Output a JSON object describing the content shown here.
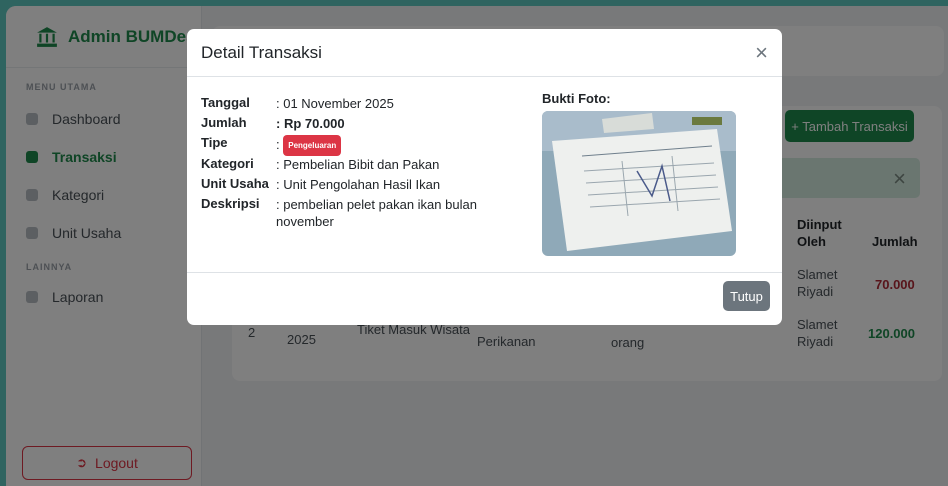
{
  "sidebar": {
    "brand": "Admin BUMDes",
    "section_main": "MENU UTAMA",
    "items_main": [
      {
        "label": "Dashboard"
      },
      {
        "label": "Transaksi"
      },
      {
        "label": "Kategori"
      },
      {
        "label": "Unit Usaha"
      }
    ],
    "section_other": "LAINNYA",
    "items_other": [
      {
        "label": "Laporan"
      }
    ],
    "logout_label": "Logout"
  },
  "main": {
    "add_button": "+ Tambah Transaksi",
    "table_headers": {
      "diinput_oleh": "Diinput Oleh",
      "jumlah": "Jumlah"
    },
    "rows": [
      {
        "diinput": "Slamet Riyadi",
        "jumlah": "70.000"
      },
      {
        "no": "2",
        "tanggal": "2025",
        "deskripsi": "Tiket Masuk Wisata",
        "unit": "Perikanan",
        "extra": "orang",
        "diinput": "Slamet Riyadi",
        "jumlah": "120.000"
      }
    ]
  },
  "modal": {
    "title": "Detail Transaksi",
    "fields": [
      {
        "key": "Tanggal",
        "value": ": 01 November 2025"
      },
      {
        "key": "Jumlah",
        "value": ": Rp 70.000"
      },
      {
        "key": "Tipe",
        "prefix": ": ",
        "badge": "Pengeluaran"
      },
      {
        "key": "Kategori",
        "value": ": Pembelian Bibit dan Pakan"
      },
      {
        "key": "Unit Usaha",
        "value": ": Unit Pengolahan Hasil Ikan"
      },
      {
        "key": "Deskripsi",
        "value": ": pembelian pelet pakan ikan bulan november"
      }
    ],
    "photo_label": "Bukti Foto:",
    "close_button": "Tutup"
  },
  "colors": {
    "brand": "#1f8a4c",
    "danger": "#dc3545",
    "secondary": "#6c757d"
  }
}
